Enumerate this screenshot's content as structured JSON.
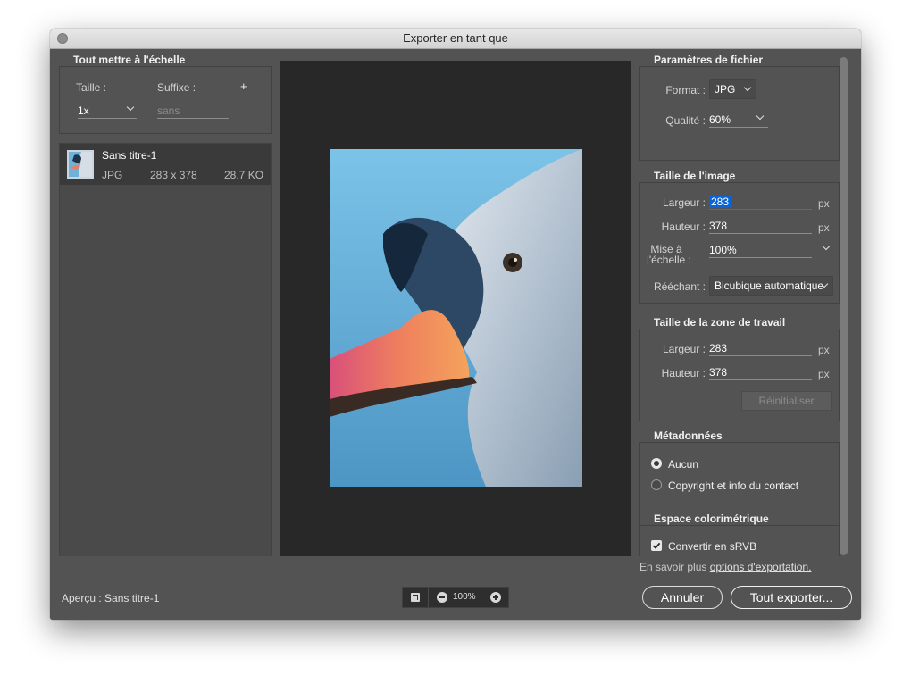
{
  "window": {
    "title": "Exporter en tant que"
  },
  "scale_group": {
    "title": "Tout mettre à l'échelle",
    "size_label": "Taille :",
    "suffix_label": "Suffixe :",
    "add_symbol": "+",
    "size_value": "1x",
    "suffix_placeholder": "sans"
  },
  "asset": {
    "name": "Sans titre-1",
    "format": "JPG",
    "dimensions": "283 x 378",
    "filesize": "28.7 KO"
  },
  "file_settings": {
    "title": "Paramètres de fichier",
    "format_label": "Format :",
    "format_value": "JPG",
    "quality_label": "Qualité :",
    "quality_value": "60%"
  },
  "image_size": {
    "title": "Taille de l'image",
    "width_label": "Largeur :",
    "width_value": "283",
    "height_label": "Hauteur :",
    "height_value": "378",
    "scale_label_1": "Mise à",
    "scale_label_2": "l'échelle :",
    "scale_value": "100%",
    "resample_label": "Rééchant :",
    "resample_value": "Bicubique automatique",
    "unit": "px"
  },
  "canvas_size": {
    "title": "Taille de la zone de travail",
    "width_label": "Largeur :",
    "width_value": "283",
    "height_label": "Hauteur :",
    "height_value": "378",
    "unit": "px",
    "reset_label": "Réinitialiser"
  },
  "metadata": {
    "title": "Métadonnées",
    "option_none": "Aucun",
    "option_copyright": "Copyright et info du contact",
    "selected": "none"
  },
  "color_space": {
    "title": "Espace colorimétrique",
    "convert_label": "Convertir en sRVB",
    "convert_checked": true
  },
  "footer": {
    "learn_prefix": "En savoir plus ",
    "learn_link": "options d'exportation.",
    "preview_label": "Aperçu : Sans titre-1",
    "zoom_value": "100%",
    "cancel_label": "Annuler",
    "export_label": "Tout exporter..."
  },
  "colors": {
    "window_bg": "#535353",
    "preview_bg": "#282828",
    "selection": "#0a64d6"
  }
}
